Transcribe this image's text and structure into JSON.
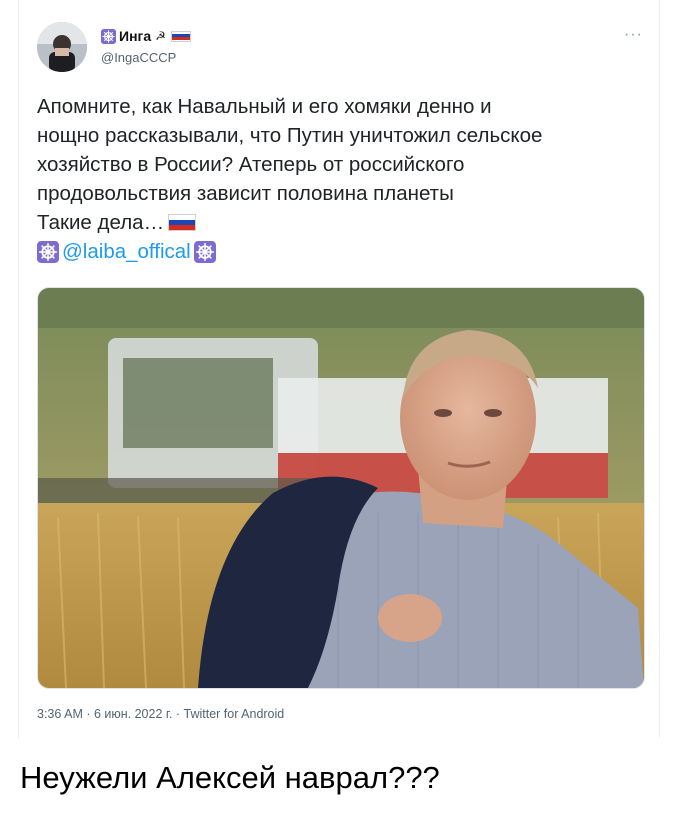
{
  "tweet": {
    "display_name": "Инга",
    "handle": "@IngaCCCP",
    "more_glyph": "···",
    "text_lines": [
      "Апомните, как Навальный и его хомяки денно и",
      "нощно рассказывали, что Путин уничтожил сельское",
      "хозяйство в России? Атеперь от российского",
      "продовольствия зависит половина планеты",
      "Такие дела…"
    ],
    "mention": "@laiba_offical",
    "timestamp": "3:36 AM · 6 июн. 2022 г. · Twitter for Android",
    "icons": {
      "wheel": "ship-wheel-icon",
      "hammer": "hammer-sickle-icon",
      "flag": "russia-flag-icon",
      "more": "more-dots-icon"
    }
  },
  "caption": "Неужели Алексей наврал???",
  "colors": {
    "link": "#1d9bf0",
    "muted": "#536471",
    "flag_blue": "#1c47b5",
    "flag_red": "#d52b1e"
  }
}
